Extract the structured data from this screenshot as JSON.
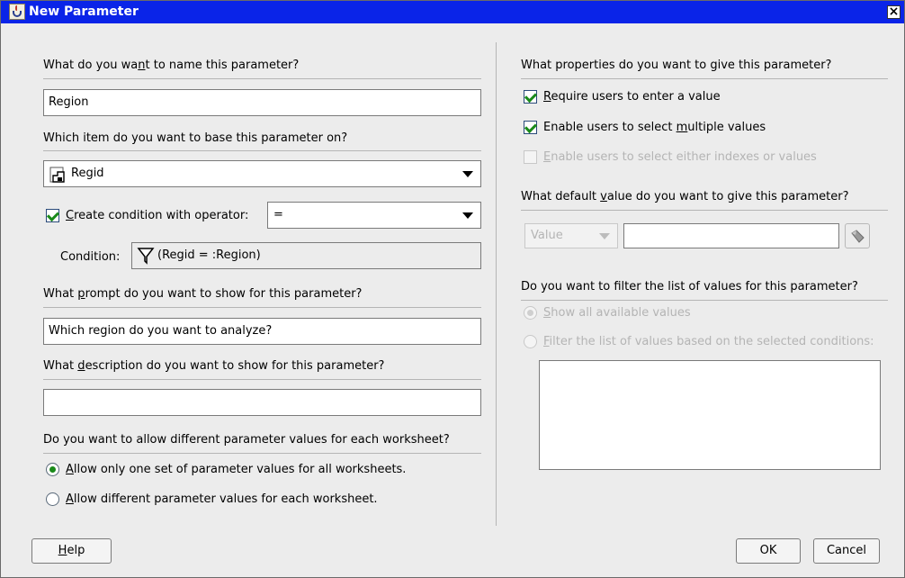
{
  "window": {
    "title": "New Parameter",
    "close_glyph": "×"
  },
  "left": {
    "name_question": {
      "pre": "What do you wa",
      "u": "n",
      "post": "t to name this parameter?"
    },
    "name_value": "Region",
    "base_question": "Which item do you want to base this parameter on?",
    "base_item": "Regid",
    "create_condition": {
      "u": "C",
      "rest": "reate condition with operator:",
      "checked": true
    },
    "operator_value": "=",
    "condition_label": "Condition:",
    "condition_value": "(Regid = :Region)",
    "prompt_question": {
      "pre": "What ",
      "u": "p",
      "post": "rompt do you want to show for this parameter?"
    },
    "prompt_value": "Which region do you want to analyze?",
    "description_question": {
      "pre": "What ",
      "u": "d",
      "post": "escription do you want to show for this parameter?"
    },
    "description_value": "",
    "worksheet_question": "Do you want to allow different parameter values for each worksheet?",
    "radio_one_set": {
      "u": "A",
      "rest": "llow only one set of parameter values for all worksheets.",
      "selected": true
    },
    "radio_different": {
      "u": "A",
      "rest": "llow different parameter values for each worksheet.",
      "selected": false
    }
  },
  "right": {
    "properties_question": "What properties do you want to give this parameter?",
    "require_value": {
      "u": "R",
      "rest": "equire users to enter a value",
      "checked": true
    },
    "multiple_values": {
      "pre": "Enable users to select ",
      "u": "m",
      "post": "ultiple values",
      "checked": true
    },
    "indexes_values": {
      "u": "E",
      "rest": "nable users to select either indexes or values",
      "checked": false,
      "enabled": false
    },
    "default_question": {
      "pre": "What default ",
      "u": "v",
      "post": "alue do you want to give this parameter?"
    },
    "default_type": "Value",
    "default_value": "",
    "filter_question": "Do you want to filter the list of values for this parameter?",
    "radio_show_all": {
      "u": "S",
      "rest": "how all available values",
      "selected": true,
      "enabled": false
    },
    "radio_filter": {
      "u": "F",
      "rest": "ilter the list of values based on the selected conditions:",
      "selected": false,
      "enabled": false
    }
  },
  "buttons": {
    "help": {
      "u": "H",
      "rest": "elp"
    },
    "ok": "OK",
    "cancel": "Cancel"
  },
  "icons": [
    "java-app-icon",
    "close-icon",
    "item-icon",
    "filter-icon",
    "dropdown-arrow-icon",
    "flashlight-icon"
  ]
}
